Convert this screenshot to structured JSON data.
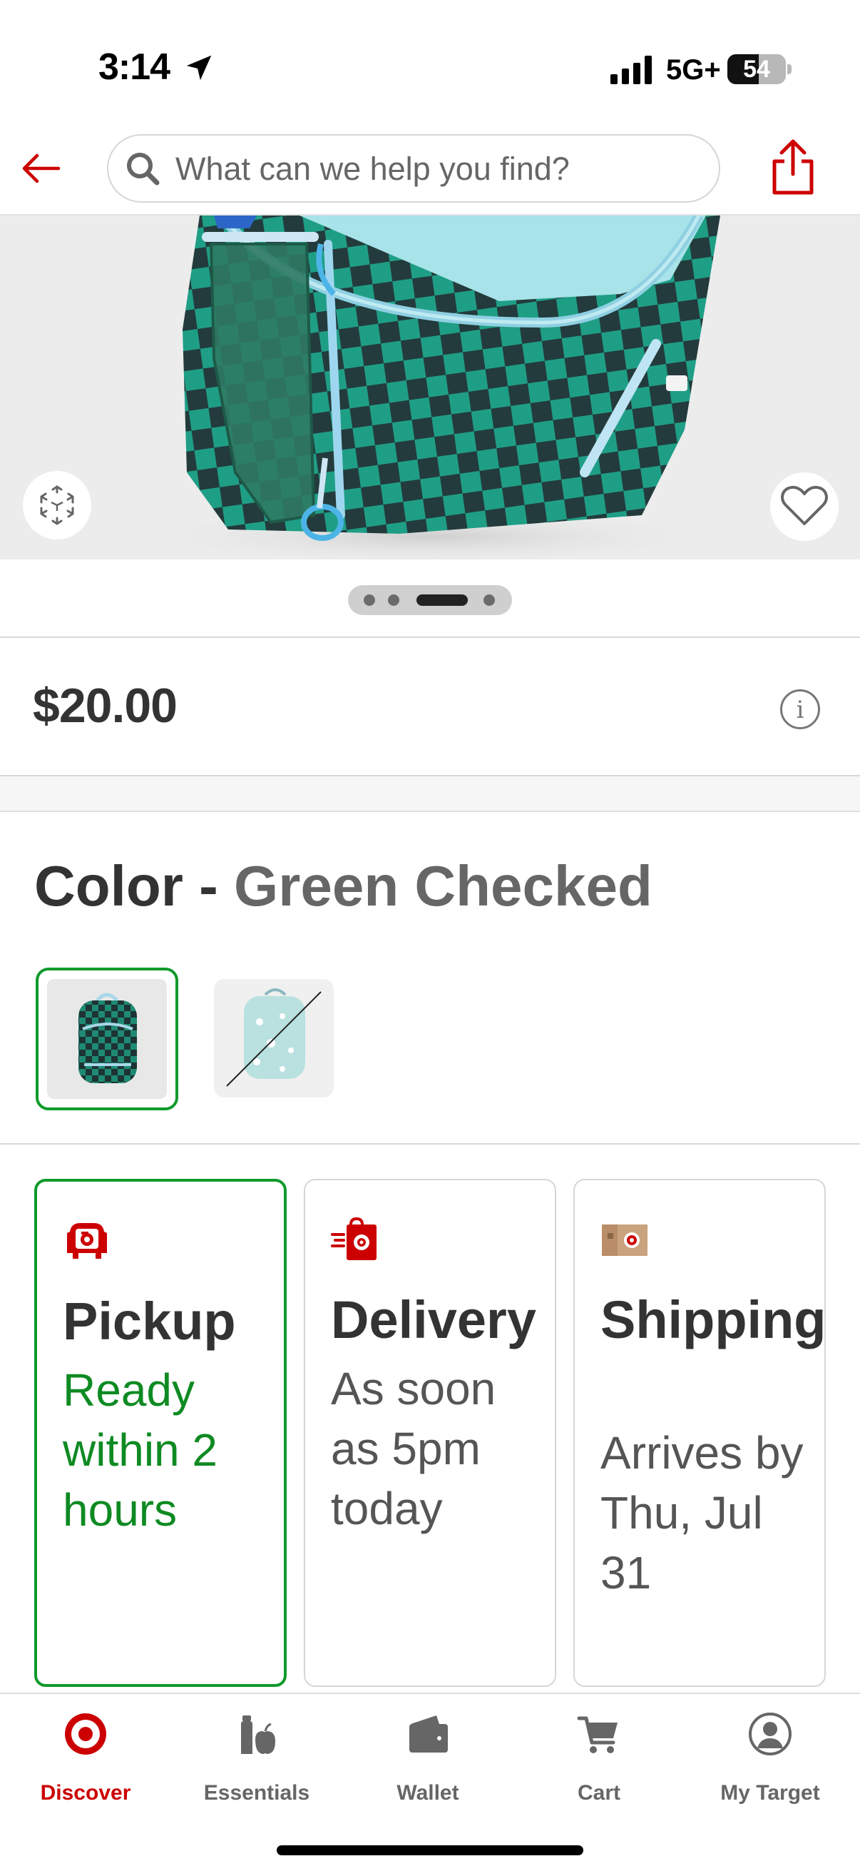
{
  "status": {
    "time": "3:14",
    "network": "5G+",
    "battery": "54",
    "battery_level": 0.54
  },
  "header": {
    "search_placeholder": "What can we help you find?"
  },
  "product": {
    "price": "$20.00",
    "color_label": "Color - ",
    "color_value": "Green Checked",
    "image_index": 3,
    "image_count": 4
  },
  "fulfillment": [
    {
      "title": "Pickup",
      "detail": "Ready within 2 hours",
      "status_color": "#0e8a22"
    },
    {
      "title": "Delivery",
      "detail": "As soon as 5pm today",
      "status_color": "#555555"
    },
    {
      "title": "Shipping",
      "detail": "Arrives by Thu, Jul 31",
      "status_color": "#555555"
    }
  ],
  "tabs": [
    {
      "label": "Discover",
      "icon": "bullseye-icon"
    },
    {
      "label": "Essentials",
      "icon": "grocery-icon"
    },
    {
      "label": "Wallet",
      "icon": "wallet-icon"
    },
    {
      "label": "Cart",
      "icon": "cart-icon"
    },
    {
      "label": "My Target",
      "icon": "profile-icon"
    }
  ],
  "colors": {
    "accent": "#cc0000",
    "selected": "#0e9a2b",
    "teal": "#1f9e86"
  }
}
